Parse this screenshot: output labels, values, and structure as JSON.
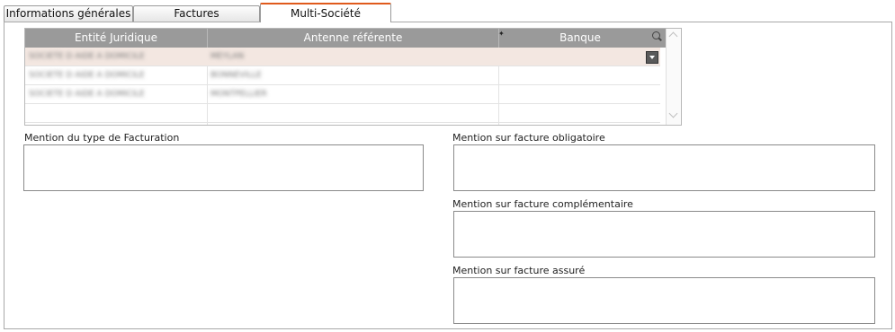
{
  "tabs": [
    {
      "label": "Informations générales",
      "active": false
    },
    {
      "label": "Factures",
      "active": false
    },
    {
      "label": "Multi-Société",
      "active": true
    }
  ],
  "grid": {
    "columns": [
      "Entité Juridique",
      "Antenne référente",
      "Banque"
    ],
    "rows": [
      {
        "entite": "SOCIETE D AIDE A DOMICILE",
        "antenne": "MEYLAN",
        "banque": "",
        "selected": true
      },
      {
        "entite": "SOCIETE D AIDE A DOMICILE",
        "antenne": "BONNEVILLE",
        "banque": "",
        "selected": false
      },
      {
        "entite": "SOCIETE D AIDE A DOMICILE",
        "antenne": "MONTPELLIER",
        "banque": "",
        "selected": false
      }
    ]
  },
  "fields": {
    "mention_type_facturation": {
      "label": "Mention du type de Facturation",
      "value": ""
    },
    "mention_obligatoire": {
      "label": "Mention sur facture obligatoire",
      "value": ""
    },
    "mention_complementaire": {
      "label": "Mention sur facture complémentaire",
      "value": ""
    },
    "mention_assure": {
      "label": "Mention sur facture assuré",
      "value": ""
    }
  },
  "colors": {
    "active_tab_accent": "#e05a1c",
    "grid_header": "#9a9a9a",
    "selected_row": "#f3e7e1"
  },
  "icons": [
    "search-icon",
    "sort-icon",
    "dropdown-arrow-icon",
    "scroll-up-icon",
    "scroll-down-icon"
  ]
}
